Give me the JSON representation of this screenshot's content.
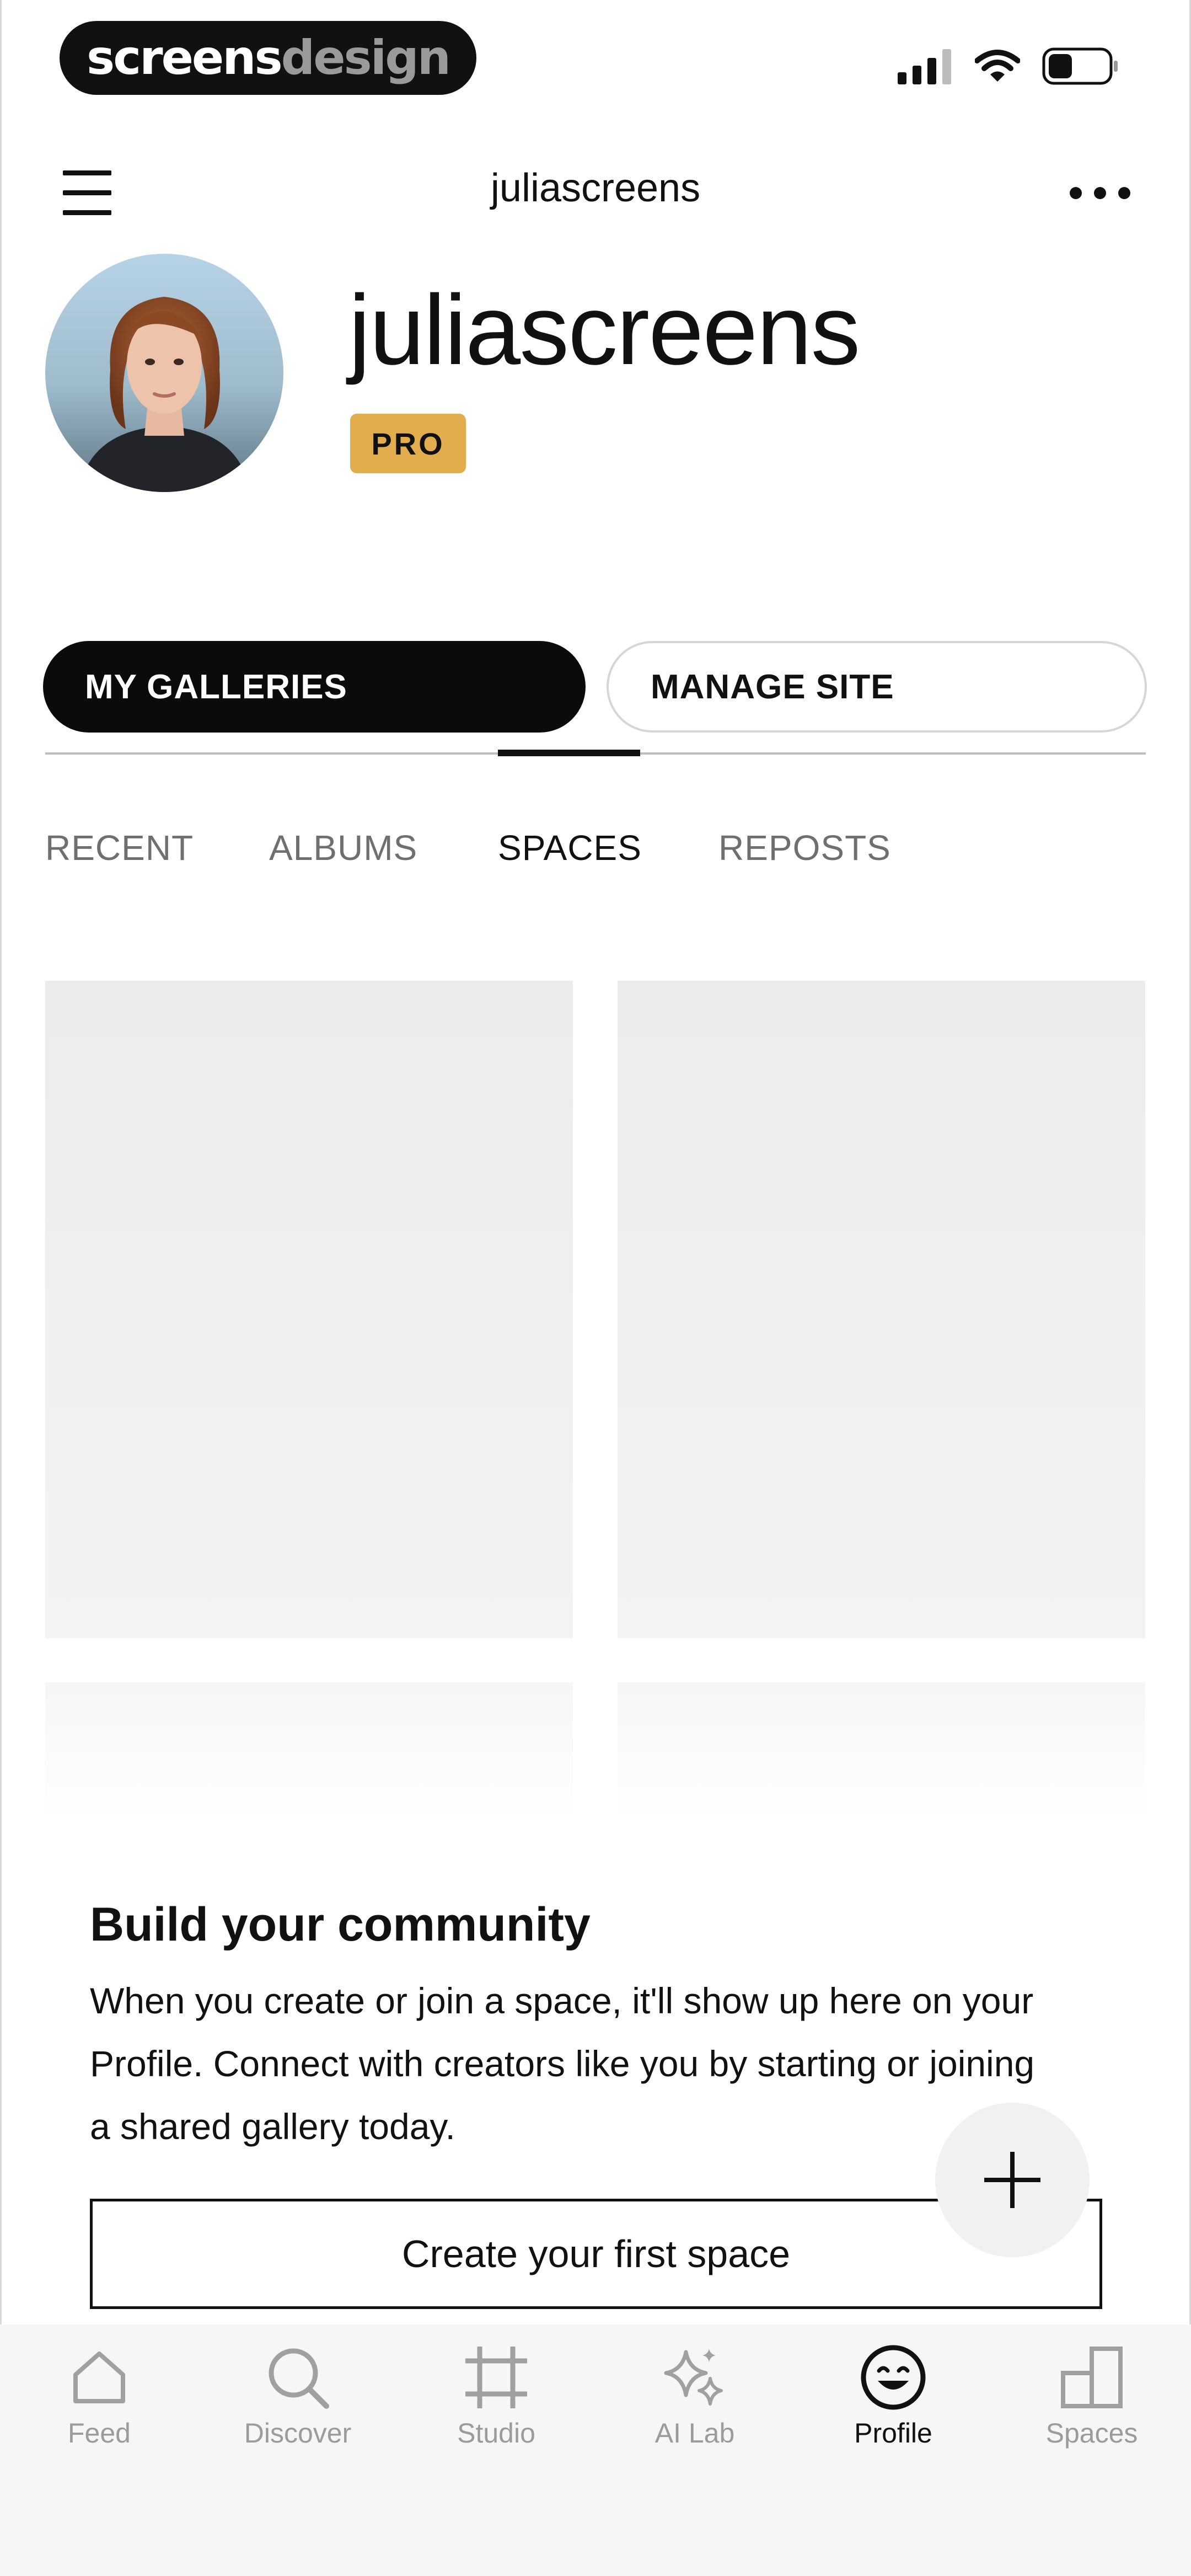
{
  "status_bar": {
    "brand_part1": "screens",
    "brand_part2": "design",
    "icons": [
      "cellular-signal-icon",
      "wifi-icon",
      "battery-icon"
    ]
  },
  "header": {
    "title": "juliascreens",
    "menu_icon": "hamburger-menu-icon",
    "more_icon": "more-dots-icon"
  },
  "profile": {
    "name": "juliascreens",
    "badge": "PRO",
    "badge_color": "#e2ae4d"
  },
  "segments": [
    {
      "label": "MY GALLERIES",
      "active": true
    },
    {
      "label": "MANAGE SITE",
      "active": false
    }
  ],
  "tabs": [
    {
      "label": "RECENT",
      "active": false
    },
    {
      "label": "ALBUMS",
      "active": false
    },
    {
      "label": "SPACES",
      "active": true
    },
    {
      "label": "REPOSTS",
      "active": false
    }
  ],
  "community": {
    "title": "Build your community",
    "line1": "When you create or join a space, it'll show up here on your",
    "line2": "Profile. Connect with creators like you by starting or joining",
    "line3": "a shared gallery today.",
    "cta": "Create your first space"
  },
  "fab": {
    "icon": "plus-icon"
  },
  "bottom_nav": [
    {
      "label": "Feed",
      "icon": "home-icon",
      "active": false
    },
    {
      "label": "Discover",
      "icon": "search-icon",
      "active": false
    },
    {
      "label": "Studio",
      "icon": "crop-icon",
      "active": false
    },
    {
      "label": "AI Lab",
      "icon": "sparkle-icon",
      "active": false
    },
    {
      "label": "Profile",
      "icon": "smiley-icon",
      "active": true
    },
    {
      "label": "Spaces",
      "icon": "spaces-icon",
      "active": false
    }
  ]
}
